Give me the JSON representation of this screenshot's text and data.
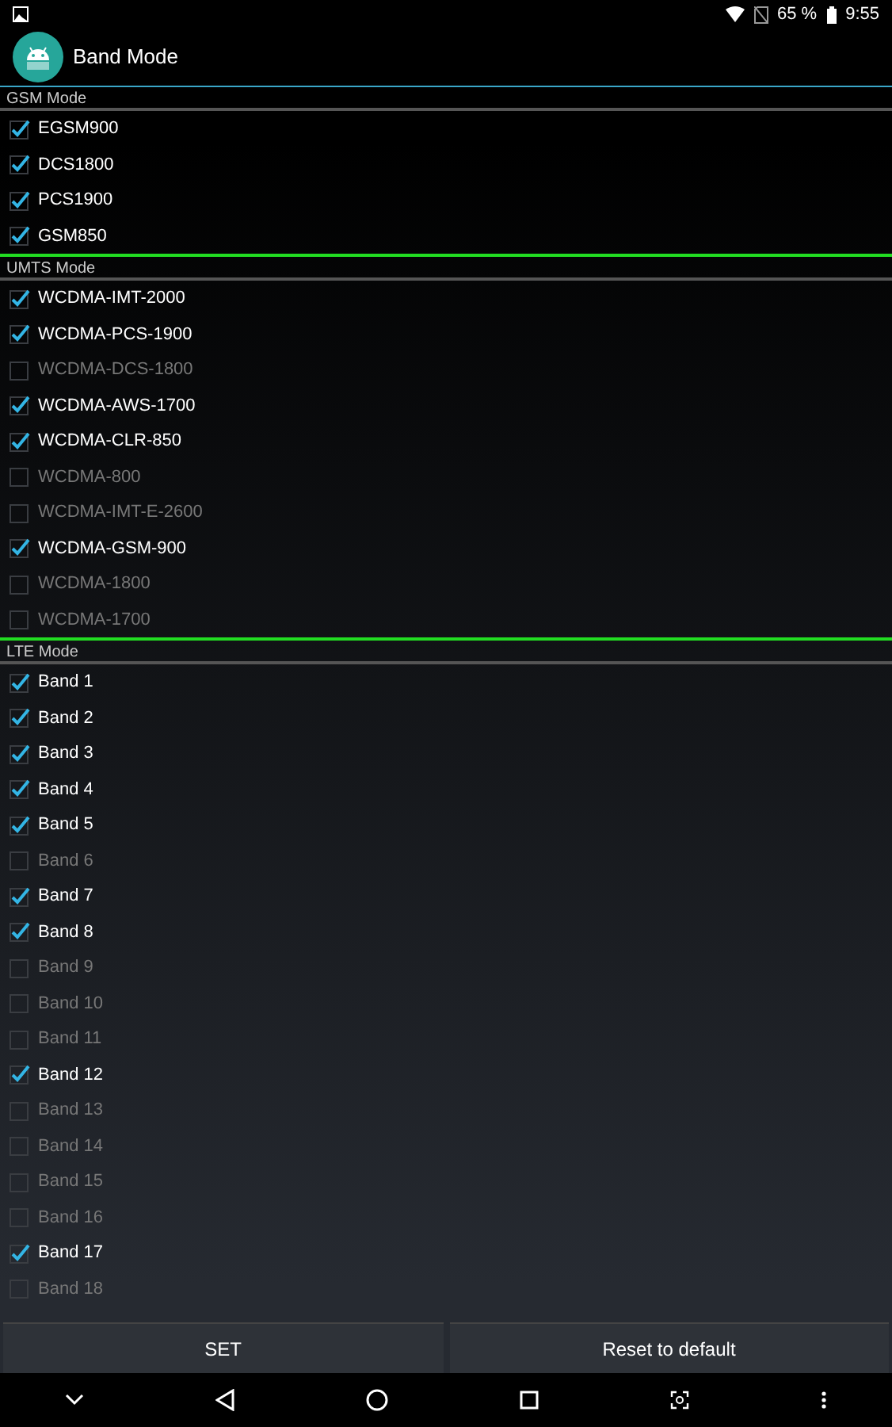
{
  "status_bar": {
    "battery": "65 %",
    "time": "9:55"
  },
  "app_bar": {
    "title": "Band Mode"
  },
  "sections": [
    {
      "title": "GSM Mode",
      "divider_below": true,
      "items": [
        {
          "label": "EGSM900",
          "checked": true
        },
        {
          "label": "DCS1800",
          "checked": true
        },
        {
          "label": "PCS1900",
          "checked": true
        },
        {
          "label": "GSM850",
          "checked": true
        }
      ]
    },
    {
      "title": "UMTS Mode",
      "divider_below": true,
      "items": [
        {
          "label": "WCDMA-IMT-2000",
          "checked": true
        },
        {
          "label": "WCDMA-PCS-1900",
          "checked": true
        },
        {
          "label": "WCDMA-DCS-1800",
          "checked": false
        },
        {
          "label": "WCDMA-AWS-1700",
          "checked": true
        },
        {
          "label": "WCDMA-CLR-850",
          "checked": true
        },
        {
          "label": "WCDMA-800",
          "checked": false
        },
        {
          "label": "WCDMA-IMT-E-2600",
          "checked": false
        },
        {
          "label": "WCDMA-GSM-900",
          "checked": true
        },
        {
          "label": "WCDMA-1800",
          "checked": false
        },
        {
          "label": "WCDMA-1700",
          "checked": false
        }
      ]
    },
    {
      "title": "LTE Mode",
      "items": [
        {
          "label": "Band 1",
          "checked": true
        },
        {
          "label": "Band 2",
          "checked": true
        },
        {
          "label": "Band 3",
          "checked": true
        },
        {
          "label": "Band 4",
          "checked": true
        },
        {
          "label": "Band 5",
          "checked": true
        },
        {
          "label": "Band 6",
          "checked": false
        },
        {
          "label": "Band 7",
          "checked": true
        },
        {
          "label": "Band 8",
          "checked": true
        },
        {
          "label": "Band 9",
          "checked": false
        },
        {
          "label": "Band 10",
          "checked": false
        },
        {
          "label": "Band 11",
          "checked": false
        },
        {
          "label": "Band 12",
          "checked": true
        },
        {
          "label": "Band 13",
          "checked": false
        },
        {
          "label": "Band 14",
          "checked": false
        },
        {
          "label": "Band 15",
          "checked": false
        },
        {
          "label": "Band 16",
          "checked": false
        },
        {
          "label": "Band 17",
          "checked": true
        },
        {
          "label": "Band 18",
          "checked": false
        }
      ]
    }
  ],
  "buttons": [
    "SET",
    "Reset to default"
  ]
}
